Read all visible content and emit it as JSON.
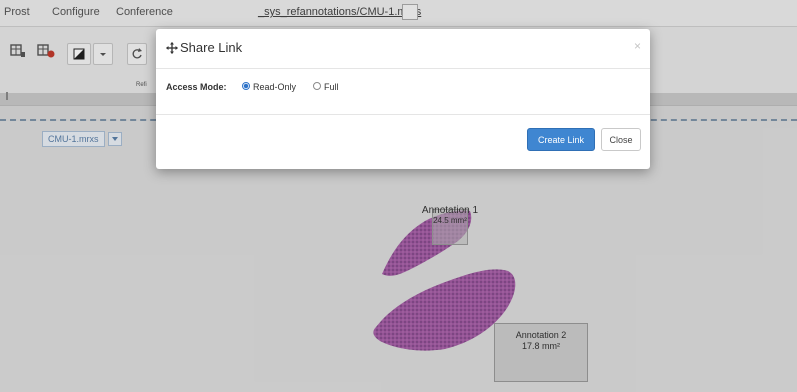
{
  "menubar": {
    "items": [
      "Prost",
      "Configure",
      "Conference"
    ],
    "file_path": "_sys_refannotations/CMU-1.mrxs"
  },
  "toolbar": {
    "label_fragment": "Refi"
  },
  "viewer": {
    "image_select": "CMU-1.mrxs",
    "annotations": [
      {
        "name": "Annotation 1",
        "area": "24.5 mm²"
      },
      {
        "name": "Annotation 2",
        "area": "17.8 mm²"
      }
    ]
  },
  "modal": {
    "title": "Share Link",
    "access_label": "Access Mode:",
    "options": [
      {
        "label": "Read-Only",
        "selected": true
      },
      {
        "label": "Full",
        "selected": false
      }
    ],
    "create_button": "Create Link",
    "close_button": "Close",
    "close_symbol": "×"
  },
  "colors": {
    "primary": "#3f86d1",
    "tissue": "#8a3c8f"
  }
}
